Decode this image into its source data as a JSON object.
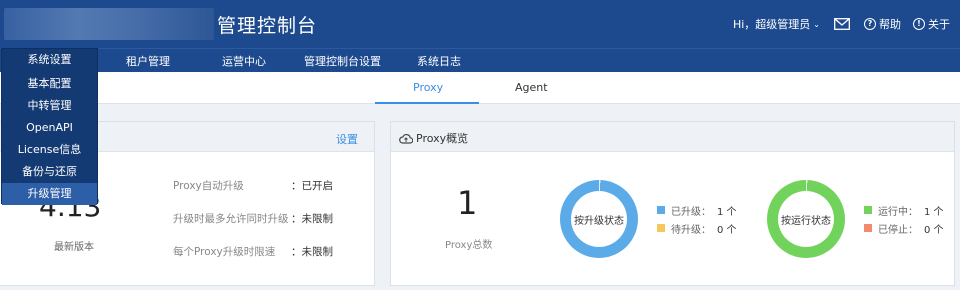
{
  "header": {
    "app_title": "管理控制台",
    "user_greeting": "Hi，超级管理员",
    "help_label": "帮助",
    "about_label": "关于"
  },
  "nav": {
    "items": [
      "系统设置",
      "租户管理",
      "运营中心",
      "管理控制台设置",
      "系统日志"
    ]
  },
  "dropdown": {
    "items": [
      "基本配置",
      "中转管理",
      "OpenAPI",
      "License信息",
      "备份与还原",
      "升级管理"
    ],
    "active_index": 5
  },
  "tabs": {
    "items": [
      "Proxy",
      "Agent"
    ],
    "active": "Proxy"
  },
  "upgrade_card": {
    "settings_link": "设置",
    "version": "4.13",
    "version_label": "最新版本",
    "settings": [
      {
        "label": "Proxy自动升级",
        "value": "：已开启"
      },
      {
        "label": "升级时最多允许同时升级",
        "value": "：未限制"
      },
      {
        "label": "每个Proxy升级时限速",
        "value": "：未限制"
      }
    ]
  },
  "overview_card": {
    "title": "Proxy概览",
    "total": "1",
    "total_label": "Proxy总数",
    "upgrade_status": {
      "center_label": "按升级状态",
      "legend": [
        {
          "label": "已升级：",
          "value": "1 个",
          "color": "#5aabe8"
        },
        {
          "label": "待升级：",
          "value": "0 个",
          "color": "#f7c65c"
        }
      ]
    },
    "run_status": {
      "center_label": "按运行状态",
      "legend": [
        {
          "label": "运行中：",
          "value": "1 个",
          "color": "#71d35b"
        },
        {
          "label": "已停止：",
          "value": "0 个",
          "color": "#f18a6e"
        }
      ]
    }
  },
  "colors": {
    "header_bg": "#1d4a8e",
    "dropdown_bg": "#143a74",
    "accent": "#3a8ee6",
    "donut_blue": "#5aabe8",
    "donut_green": "#71d35b"
  },
  "icons": [
    "chevron-down-icon",
    "mail-icon",
    "help-circle-icon",
    "info-circle-icon",
    "cloud-icon"
  ]
}
